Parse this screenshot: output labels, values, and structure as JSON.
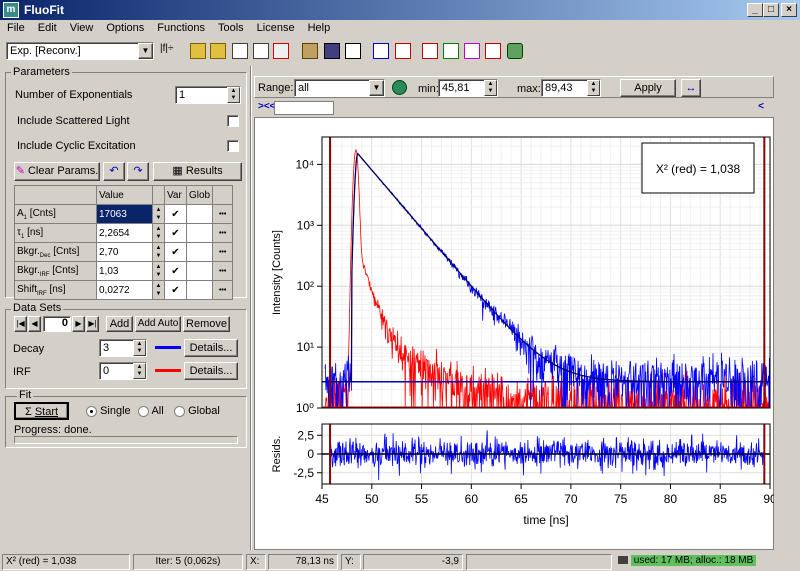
{
  "window": {
    "title": "FluoFit"
  },
  "menu": [
    "File",
    "Edit",
    "View",
    "Options",
    "Functions",
    "Tools",
    "License",
    "Help"
  ],
  "toolbar": {
    "model_select": "Exp. [Reconv.]"
  },
  "parameters": {
    "group_label": "Parameters",
    "num_exp_label": "Number of Exponentials",
    "num_exp_value": "1",
    "scattered_label": "Include Scattered Light",
    "cyclic_label": "Include Cyclic Excitation",
    "clear_label": "Clear Params.",
    "results_label": "Results",
    "col_value": "Value",
    "col_var": "Var",
    "col_glob": "Glob",
    "rows": [
      {
        "name": "A",
        "sub": "1",
        "unit": " [Cnts]",
        "value": "17063",
        "var": "✔",
        "dots": "•••"
      },
      {
        "name": "τ",
        "sub": "1",
        "unit": " [ns]",
        "value": "2,2654",
        "var": "✔",
        "dots": "•••"
      },
      {
        "name": "Bkgr.",
        "sub": "Dec",
        "unit": " [Cnts]",
        "value": "2,70",
        "var": "✔",
        "dots": "•••"
      },
      {
        "name": "Bkgr.",
        "sub": "IRF",
        "unit": " [Cnts]",
        "value": "1,03",
        "var": "✔",
        "dots": "•••"
      },
      {
        "name": "Shift",
        "sub": "IRF",
        "unit": " [ns]",
        "value": "0,0272",
        "var": "✔",
        "dots": "•••"
      }
    ]
  },
  "datasets": {
    "group_label": "Data Sets",
    "index": "0",
    "add": "Add",
    "add_auto": "Add Auto",
    "remove": "Remove",
    "decay_label": "Decay",
    "decay_value": "3",
    "irf_label": "IRF",
    "irf_value": "0",
    "details": "Details..."
  },
  "fit": {
    "group_label": "Fit",
    "start": "Start",
    "single": "Single",
    "all": "All",
    "global": "Global",
    "progress": "Progress:  done."
  },
  "range": {
    "label": "Range:",
    "value": "all",
    "min_label": "min:",
    "min_value": "45,81",
    "max_label": "max:",
    "max_value": "89,43",
    "apply": "Apply",
    "nav_left": "><<",
    "nav_right": "<"
  },
  "colors": {
    "decay": "#0000ff",
    "irf": "#ff0000",
    "fit": "#000060",
    "cursor": "#8b0000"
  },
  "chart_data": {
    "type": "line",
    "ylabel": "Intensity [Counts]",
    "xlabel": "time [ns]",
    "resid_label": "Resids.",
    "x_ticks": [
      "45",
      "50",
      "55",
      "60",
      "65",
      "70",
      "75",
      "80",
      "85",
      "90"
    ],
    "y_ticks": [
      "10⁰",
      "10¹",
      "10²",
      "10³",
      "10⁴"
    ],
    "resid_ticks": [
      "2,5",
      "0",
      "-2,5"
    ],
    "xlim": [
      45,
      90
    ],
    "ylim_log10": [
      0,
      4.45
    ],
    "resid_ylim": [
      -4,
      4
    ],
    "chi_label": "X² (red) = 1,038",
    "decay_tau": 2.2654,
    "decay_amp": 15000,
    "decay_bkg": 2.7,
    "decay_peak_x": 48.6,
    "irf_peak_x": 48.4,
    "irf_amp": 17000,
    "irf_bkg": 1.03,
    "range_min": 45.81,
    "range_max": 89.43,
    "series": [
      {
        "name": "Decay",
        "values": []
      },
      {
        "name": "IRF",
        "values": []
      },
      {
        "name": "Fit",
        "values": []
      }
    ]
  },
  "status": {
    "chi": "X² (red) = 1,038",
    "iter": "Iter: 5 (0,062s)",
    "x_label": "X:",
    "x_value": "78,13 ns",
    "y_label": "Y:",
    "y_value": "-3,9",
    "mem": "used: 17 MB; alloc.: 18 MB"
  }
}
